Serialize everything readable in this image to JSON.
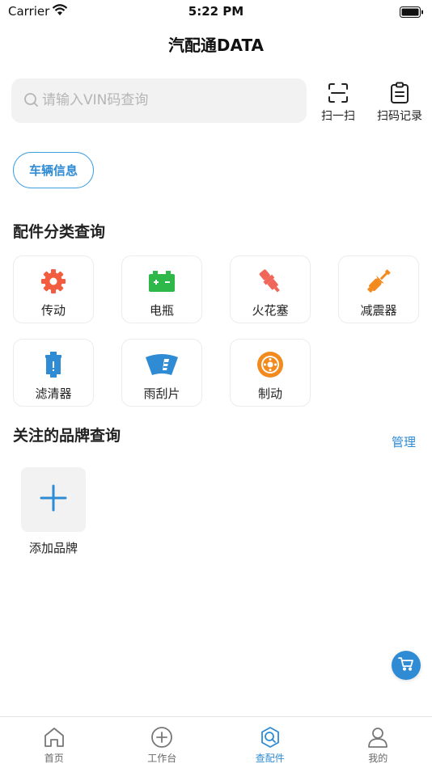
{
  "status_bar": {
    "carrier": "Carrier",
    "time": "5:22 PM"
  },
  "nav": {
    "title": "汽配通DATA"
  },
  "search": {
    "placeholder": "请输入VIN码查询",
    "value": ""
  },
  "toolbar": {
    "scan_label": "扫一扫",
    "history_label": "扫码记录"
  },
  "vehicle_info_label": "车辆信息",
  "parts_section": {
    "title": "配件分类查询",
    "categories": [
      {
        "label": "传动",
        "icon": "gear-icon"
      },
      {
        "label": "电瓶",
        "icon": "battery-icon"
      },
      {
        "label": "火花塞",
        "icon": "spark-plug-icon"
      },
      {
        "label": "减震器",
        "icon": "shock-absorber-icon"
      },
      {
        "label": "滤清器",
        "icon": "filter-icon"
      },
      {
        "label": "雨刮片",
        "icon": "wiper-icon"
      },
      {
        "label": "制动",
        "icon": "brake-disc-icon"
      }
    ]
  },
  "brands_section": {
    "title": "关注的品牌查询",
    "manage_label": "管理",
    "add_label": "添加品牌"
  },
  "tabs": [
    {
      "label": "首页",
      "icon": "home-icon",
      "active": false
    },
    {
      "label": "工作台",
      "icon": "workbench-icon",
      "active": false
    },
    {
      "label": "查配件",
      "icon": "search-parts-icon",
      "active": true
    },
    {
      "label": "我的",
      "icon": "profile-icon",
      "active": false
    }
  ],
  "colors": {
    "accent": "#2f8bd3",
    "gear": "#f25c3f",
    "battery": "#2fb84a",
    "spark_plug": "#f0675a",
    "shock": "#f28a1e",
    "filter": "#2f8bd3",
    "wiper": "#2f8bd3",
    "brake": "#f28a1e"
  }
}
